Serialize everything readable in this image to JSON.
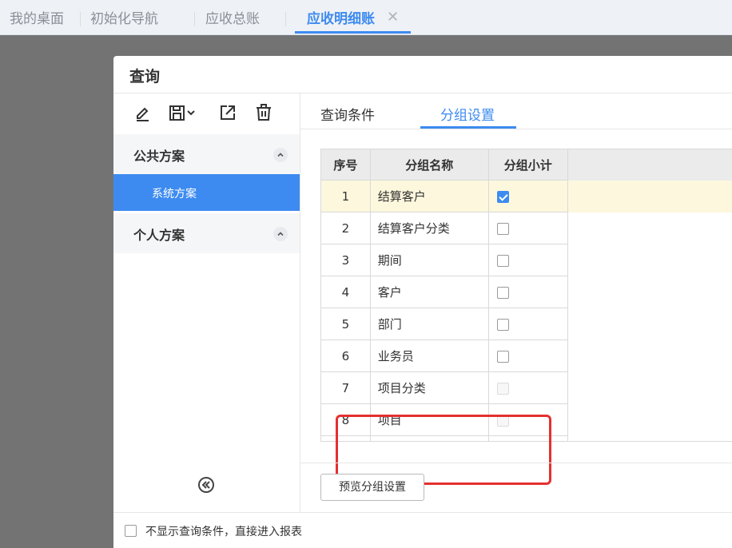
{
  "tabs": [
    {
      "label": "我的桌面"
    },
    {
      "label": "初始化导航"
    },
    {
      "label": "应收总账"
    },
    {
      "label": "应收明细账",
      "close": "✕"
    }
  ],
  "dialog": {
    "title": "查询",
    "toolbar": [
      "edit-icon",
      "save-icon",
      "export-icon",
      "delete-icon"
    ],
    "groups": {
      "public": "公共方案",
      "public_item": "系统方案",
      "personal": "个人方案"
    },
    "right_tabs": [
      "查询条件",
      "分组设置"
    ],
    "active_tab": "分组设置",
    "grid": {
      "headers": [
        "序号",
        "分组名称",
        "分组小计"
      ],
      "rows": [
        {
          "no": "1",
          "name": "结算客户",
          "checked": true
        },
        {
          "no": "2",
          "name": "结算客户分类",
          "checked": false
        },
        {
          "no": "3",
          "name": "期间",
          "checked": false
        },
        {
          "no": "4",
          "name": "客户",
          "checked": false
        },
        {
          "no": "5",
          "name": "部门",
          "checked": false
        },
        {
          "no": "6",
          "name": "业务员",
          "checked": false
        },
        {
          "no": "7",
          "name": "项目分类",
          "checked": false,
          "disabled": true
        },
        {
          "no": "8",
          "name": "项目",
          "checked": false,
          "disabled": true
        }
      ]
    },
    "preview_button": "预览分组设置",
    "footer_checkbox_label": "不显示查询条件，直接进入报表"
  },
  "colors": {
    "accent": "#3d8bf0",
    "highlight": "#e53030",
    "selected_row": "#fdf7dd"
  }
}
